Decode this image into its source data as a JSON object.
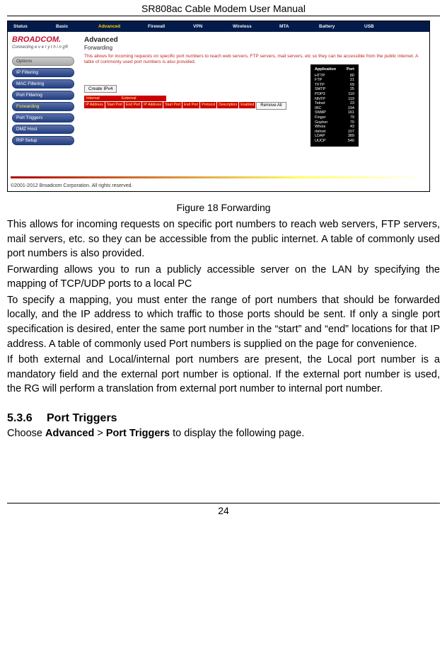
{
  "page_header": "SR808ac Cable Modem User Manual",
  "page_number": "24",
  "figure_caption": "Figure 18  Forwarding",
  "paragraphs": {
    "p1": "This allows for incoming requests on specific port numbers to reach web servers, FTP servers, mail servers, etc. so they can be accessible from the public internet. A table of commonly used port numbers is also provided.",
    "p2": "Forwarding allows you to run a publicly accessible server on the LAN by specifying the mapping of TCP/UDP ports to a local PC",
    "p3": "To specify a mapping, you must enter the range of port numbers that should be forwarded locally, and the IP address to which traffic to those ports should be sent. If only a single port specification is desired, enter the same port number in the “start” and “end” locations for that IP address.   A table of commonly used Port numbers is supplied on the page for convenience.",
    "p4": "If both external and Local/internal port numbers are present, the Local port number is a mandatory field and the external port number is optional.   If the external port number is used, the RG will perform a translation from external port number to internal port number."
  },
  "section": {
    "number": "5.3.6",
    "title": "Port Triggers"
  },
  "choose_line": {
    "pre": "Choose ",
    "nav1": "Advanced",
    "gt": " > ",
    "nav2": "Port Triggers",
    "post": " to display the following page."
  },
  "ui": {
    "topnav": {
      "items": [
        "Status",
        "Basic",
        "Advanced",
        "Firewall",
        "VPN",
        "Wireless",
        "MTA",
        "Battery",
        "USB"
      ],
      "active_index": 2
    },
    "logo": {
      "brand": "BROADCOM.",
      "tag": "Connecting  e v e r y t h i n g®"
    },
    "sidebar": {
      "items": [
        "Options",
        "IP Filtering",
        "MAC Filtering",
        "Port Filtering",
        "Forwarding",
        "Port Triggers",
        "DMZ Host",
        "RIP Setup"
      ],
      "active_index": 4
    },
    "main": {
      "title": "Advanced",
      "subtitle": "Forwarding",
      "desc": "This allows for incoming requests on specific port numbers to reach web servers, FTP servers, mail servers, etc so they can be accessible from the public internet. A table of commonly used port numbers is also provided.",
      "create_btn": "Create IPv4",
      "hdr": {
        "internal": "Internal",
        "external": "External"
      },
      "cols": [
        "IP Address",
        "Start Port",
        "End Port",
        "IP Address",
        "Start Port",
        "End Port",
        "Protocol",
        "Description",
        "Enabled"
      ],
      "remove_all": "Remove All"
    },
    "port_table": {
      "hdr_app": "Application",
      "hdr_port": "Port",
      "rows": [
        {
          "app": "HTTP",
          "port": "80"
        },
        {
          "app": "FTP",
          "port": "21"
        },
        {
          "app": "TFTP",
          "port": "69"
        },
        {
          "app": "SMTP",
          "port": "25"
        },
        {
          "app": "POP3",
          "port": "110"
        },
        {
          "app": "NNTP",
          "port": "119"
        },
        {
          "app": "Telnet",
          "port": "23"
        },
        {
          "app": "IRC",
          "port": "194"
        },
        {
          "app": "SNMP",
          "port": "161"
        },
        {
          "app": "Finger",
          "port": "79"
        },
        {
          "app": "Gopher",
          "port": "70"
        },
        {
          "app": "Whois",
          "port": "43"
        },
        {
          "app": "rtelnet",
          "port": "107"
        },
        {
          "app": "LDAP",
          "port": "389"
        },
        {
          "app": "UUCP",
          "port": "540"
        }
      ]
    },
    "copyright": "©2001-2012 Broadcom Corporation. All rights reserved."
  }
}
